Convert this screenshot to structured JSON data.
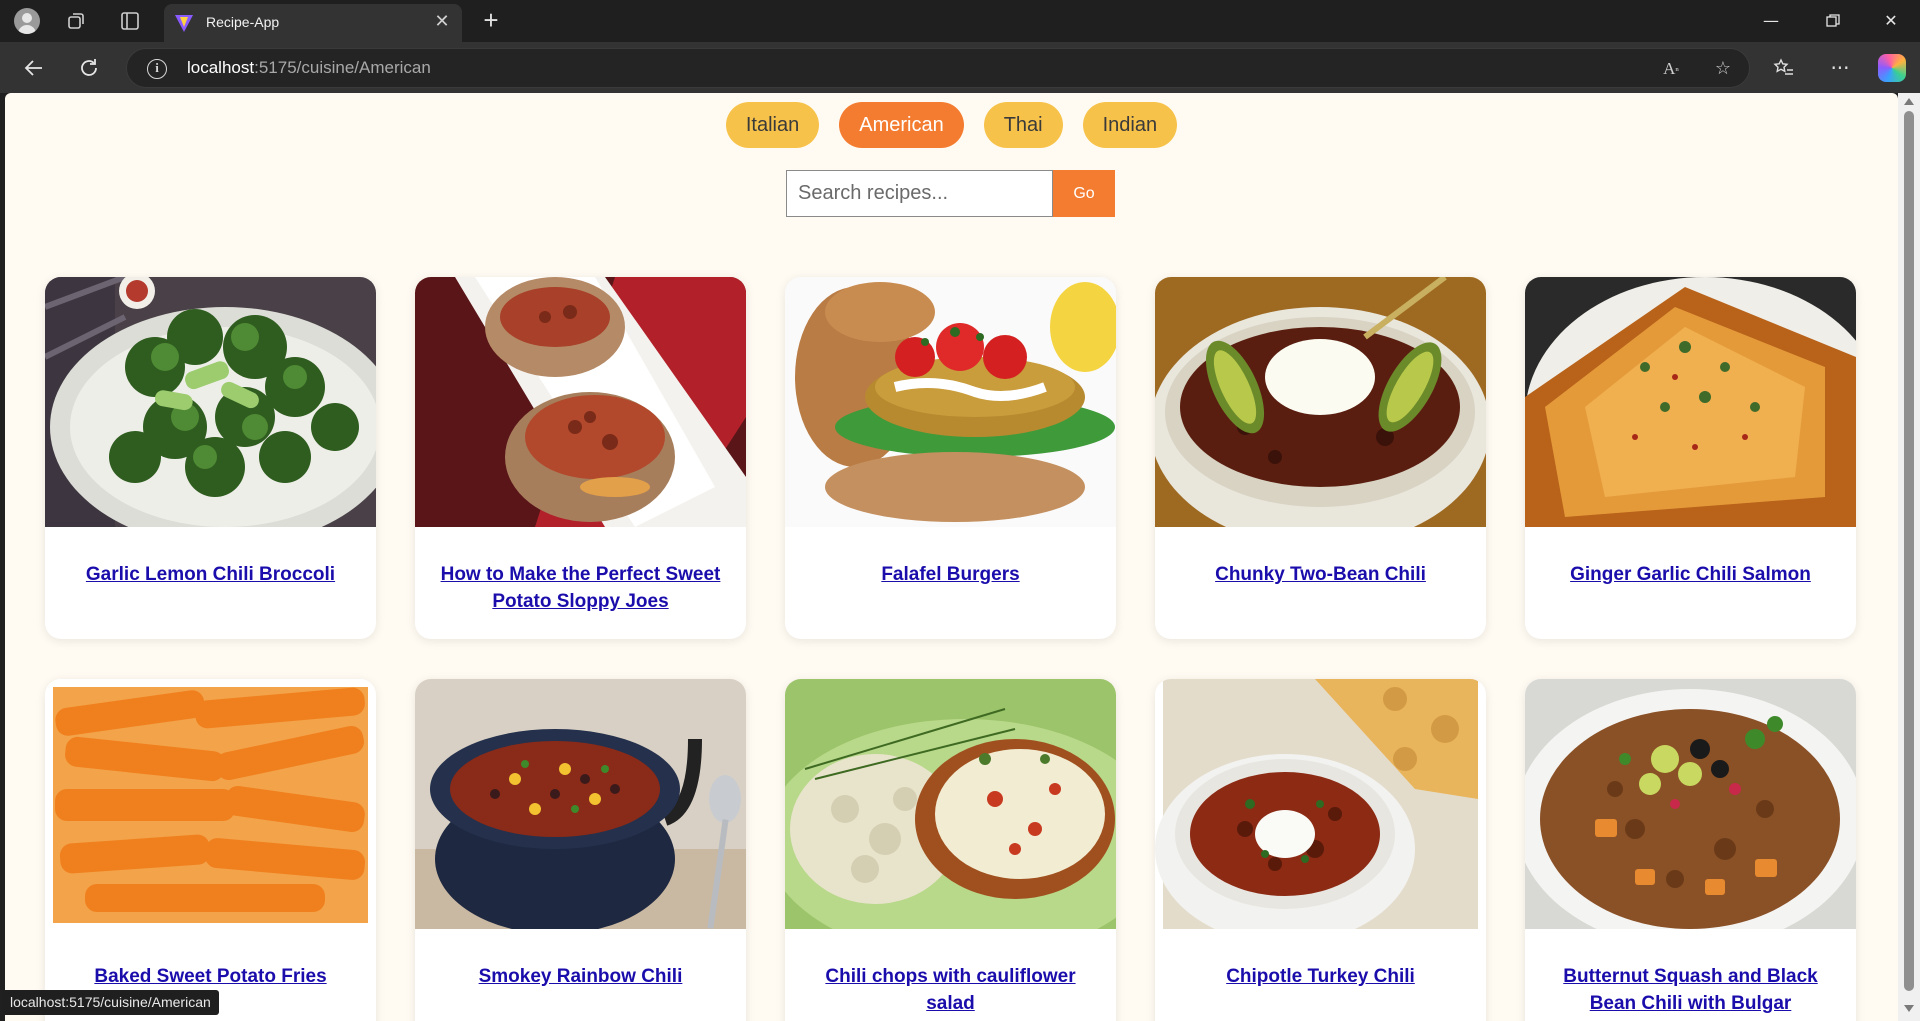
{
  "browser": {
    "tab_title": "Recipe-App",
    "url_host": "localhost",
    "url_rest": ":5175/cuisine/American",
    "status_url": "localhost:5175/cuisine/American"
  },
  "cuisines": [
    {
      "label": "Italian",
      "active": false
    },
    {
      "label": "American",
      "active": true
    },
    {
      "label": "Thai",
      "active": false
    },
    {
      "label": "Indian",
      "active": false
    }
  ],
  "search": {
    "placeholder": "Search recipes...",
    "button_label": "Go"
  },
  "recipes": [
    {
      "title": "Garlic Lemon Chili Broccoli",
      "image": "broccoli"
    },
    {
      "title": "How to Make the Perfect Sweet Potato Sloppy Joes",
      "image": "sweet-potato"
    },
    {
      "title": "Falafel Burgers",
      "image": "burger"
    },
    {
      "title": "Chunky Two-Bean Chili",
      "image": "chili-avocado"
    },
    {
      "title": "Ginger Garlic Chili Salmon",
      "image": "salmon"
    },
    {
      "title": "Baked Sweet Potato Fries",
      "image": "fries"
    },
    {
      "title": "Smokey Rainbow Chili",
      "image": "rainbow-chili"
    },
    {
      "title": "Chili chops with cauliflower salad",
      "image": "chops"
    },
    {
      "title": "Chipotle Turkey Chili",
      "image": "turkey-chili"
    },
    {
      "title": "Butternut Squash and Black Bean Chili with Bulgar",
      "image": "squash-chili"
    }
  ]
}
